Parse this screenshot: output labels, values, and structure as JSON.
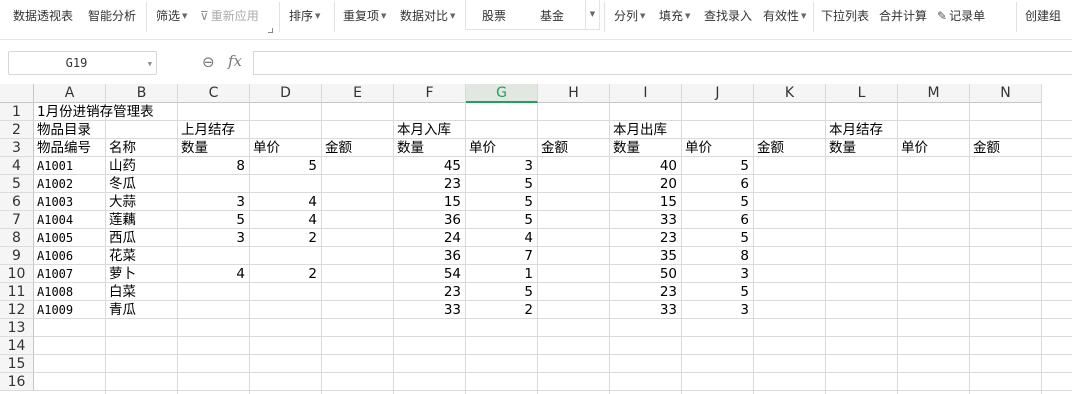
{
  "ribbon": {
    "pivot": "数据透视表",
    "smart_analysis": "智能分析",
    "filter": "筛选",
    "reapply": "重新应用",
    "sort": "排序",
    "duplicates": "重复项",
    "compare": "数据对比",
    "stocks": "股票",
    "funds": "基金",
    "split": "分列",
    "fill": "填充",
    "find_entry": "查找录入",
    "validity": "有效性",
    "dropdown_list": "下拉列表",
    "consolidate": "合并计算",
    "record_sheet": "记录单",
    "create_group": "创建组"
  },
  "formula_bar": {
    "name_box": "G19",
    "fx_label": "fx",
    "formula": ""
  },
  "columns": [
    "A",
    "B",
    "C",
    "D",
    "E",
    "F",
    "G",
    "H",
    "I",
    "J",
    "K",
    "L",
    "M",
    "N"
  ],
  "active_column": "G",
  "rows": [
    "1",
    "2",
    "3",
    "4",
    "5",
    "6",
    "7",
    "8",
    "9",
    "10",
    "11",
    "12",
    "13",
    "14",
    "15",
    "16"
  ],
  "sheet": {
    "title": "1月份进销存管理表",
    "group_labels": {
      "catalog": "物品目录",
      "last_month_stock": "上月结存",
      "month_in": "本月入库",
      "month_out": "本月出库",
      "month_stock": "本月结存"
    },
    "headers": {
      "code": "物品编号",
      "name": "名称",
      "c_qty": "数量",
      "c_price": "单价",
      "c_amount": "金额",
      "f_qty": "数量",
      "f_price": "单价",
      "f_amount": "金额",
      "i_qty": "数量",
      "i_price": "单价",
      "i_amount": "金额",
      "l_qty": "数量",
      "l_price": "单价",
      "l_amount": "金额"
    },
    "items": [
      {
        "code": "A1001",
        "name": "山药",
        "c": "8",
        "d": "5",
        "f": "45",
        "g": "3",
        "i": "40",
        "j": "5"
      },
      {
        "code": "A1002",
        "name": "冬瓜",
        "c": "",
        "d": "",
        "f": "23",
        "g": "5",
        "i": "20",
        "j": "6"
      },
      {
        "code": "A1003",
        "name": "大蒜",
        "c": "3",
        "d": "4",
        "f": "15",
        "g": "5",
        "i": "15",
        "j": "5"
      },
      {
        "code": "A1004",
        "name": "莲藕",
        "c": "5",
        "d": "4",
        "f": "36",
        "g": "5",
        "i": "33",
        "j": "6"
      },
      {
        "code": "A1005",
        "name": "西瓜",
        "c": "3",
        "d": "2",
        "f": "24",
        "g": "4",
        "i": "23",
        "j": "5"
      },
      {
        "code": "A1006",
        "name": "花菜",
        "c": "",
        "d": "",
        "f": "36",
        "g": "7",
        "i": "35",
        "j": "8"
      },
      {
        "code": "A1007",
        "name": "萝卜",
        "c": "4",
        "d": "2",
        "f": "54",
        "g": "1",
        "i": "50",
        "j": "3"
      },
      {
        "code": "A1008",
        "name": "白菜",
        "c": "",
        "d": "",
        "f": "23",
        "g": "5",
        "i": "23",
        "j": "5"
      },
      {
        "code": "A1009",
        "name": "青瓜",
        "c": "",
        "d": "",
        "f": "33",
        "g": "2",
        "i": "33",
        "j": "3"
      }
    ]
  }
}
